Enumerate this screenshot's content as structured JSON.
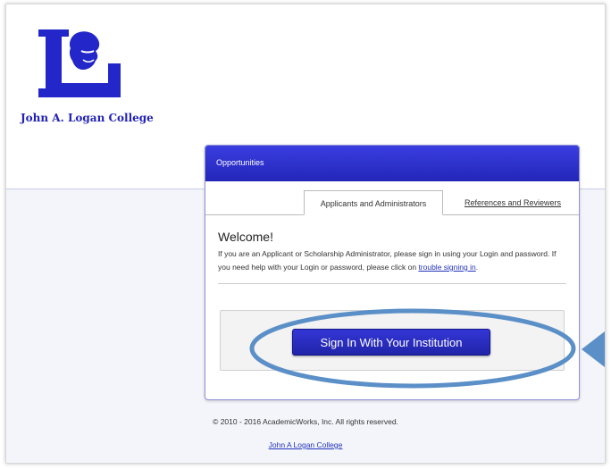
{
  "brand": {
    "name": "John A. Logan College",
    "accent": "#2326b8"
  },
  "panel": {
    "title": "Opportunities",
    "tabs": [
      {
        "label": "Applicants and Administrators",
        "active": true
      },
      {
        "label": "References and Reviewers",
        "active": false
      }
    ]
  },
  "welcome": {
    "heading": "Welcome!",
    "body": "If you are an Applicant or Scholarship Administrator, please sign in using your Login and password. If you need help with your Login or password, please click on ",
    "help_link": "trouble signing in",
    "end": "."
  },
  "signin": {
    "button_label": "Sign In With Your Institution"
  },
  "annotation": {
    "color": "#5b8fc7"
  },
  "footer": {
    "copyright": "© 2010 - 2016 AcademicWorks, Inc. All rights reserved.",
    "link": "John A Logan College"
  }
}
